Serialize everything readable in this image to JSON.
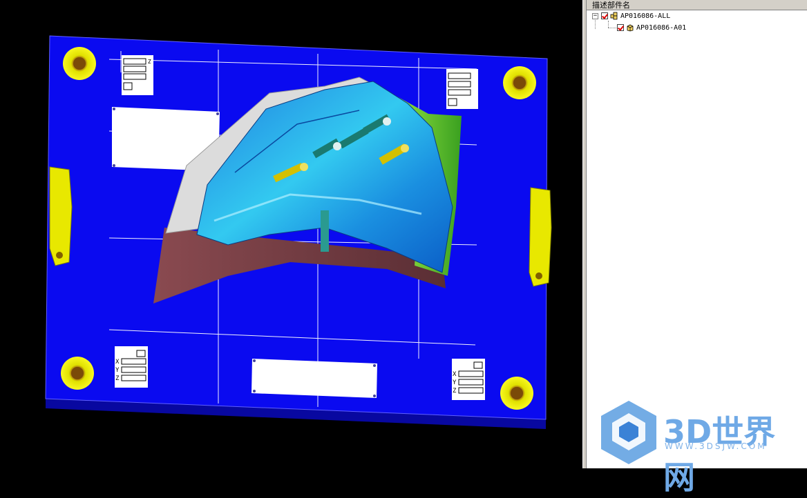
{
  "tree": {
    "header": "描述部件名",
    "items": [
      {
        "label": "AP016086-ALL",
        "checked": true,
        "expanded": true,
        "icon": "assembly-icon"
      },
      {
        "label": "AP016086-A01",
        "checked": true,
        "icon": "part-icon"
      }
    ]
  },
  "viewport": {
    "label_tags": [
      "X",
      "Y",
      "Z"
    ]
  },
  "watermark": {
    "brand": "3D世界网",
    "url": "WWW.3DSJW.COM"
  },
  "colors": {
    "plate": "#0a0af0",
    "background": "#000000",
    "cavity": "#2aa6e8",
    "accent_green": "#58c830",
    "support_yellow": "#f0f000"
  }
}
